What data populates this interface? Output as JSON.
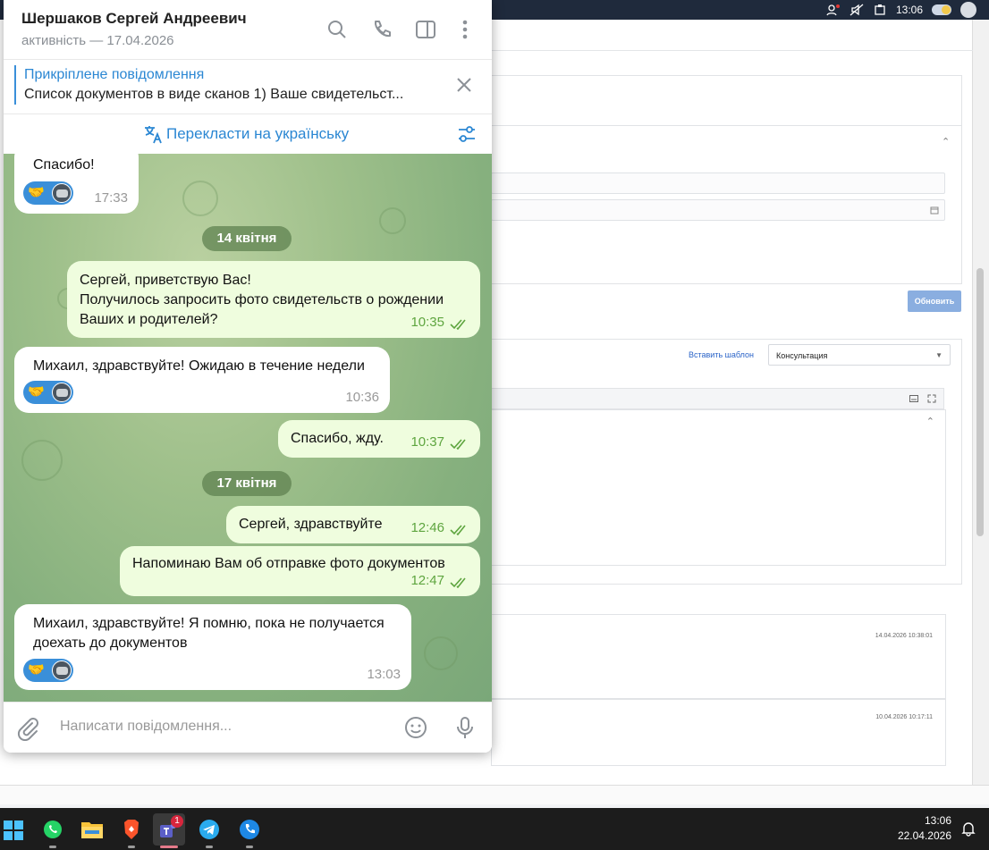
{
  "system": {
    "time_top": "13:06",
    "taskbar_time": "13:06",
    "taskbar_date": "22.04.2026",
    "teams_badge": "1"
  },
  "web": {
    "update_button": "Обновить",
    "insert_template_link": "Вставить шаблон",
    "template_select_value": "Консультация",
    "timestamp_1": "14.04.2026 10:38:01",
    "timestamp_2": "10.04.2026 10:17:11"
  },
  "telegram": {
    "contact_name": "Шершаков Сергей Андреевич",
    "contact_status": "активність — 17.04.2026",
    "pinned_title": "Прикріплене повідомлення",
    "pinned_text": "Список документов в виде сканов  1) Ваше свидетельст...",
    "translate_label": "Перекласти на українську",
    "composer_placeholder": "Написати повідомлення...",
    "date_separators": [
      "14 квітня",
      "17 квітня"
    ],
    "messages": [
      {
        "direction": "in",
        "text": "Спасибо!",
        "time": "17:33",
        "reaction": "🤝"
      },
      {
        "direction": "out",
        "text": "Сергей, приветствую Вас!\nПолучилось запросить фото свидетельств о рождении Ваших и родителей?",
        "time": "10:35"
      },
      {
        "direction": "in",
        "text": "Михаил, здравствуйте! Ожидаю в течение недели",
        "time": "10:36",
        "reaction": "🤝"
      },
      {
        "direction": "out",
        "text": "Спасибо, жду.",
        "time": "10:37"
      },
      {
        "direction": "out",
        "text": "Сергей, здравствуйте",
        "time": "12:46"
      },
      {
        "direction": "out",
        "text": "Напоминаю Вам об отправке фото документов",
        "time": "12:47"
      },
      {
        "direction": "in",
        "text": "Михаил, здравствуйте! Я помню, пока не получается доехать до документов",
        "time": "13:03",
        "reaction": "🤝"
      }
    ]
  },
  "colors": {
    "telegram_accent": "#2b87d3",
    "outgoing_bubble": "#effdde",
    "read_ticks": "#5ea53f",
    "chat_background": "#9fc08b"
  }
}
